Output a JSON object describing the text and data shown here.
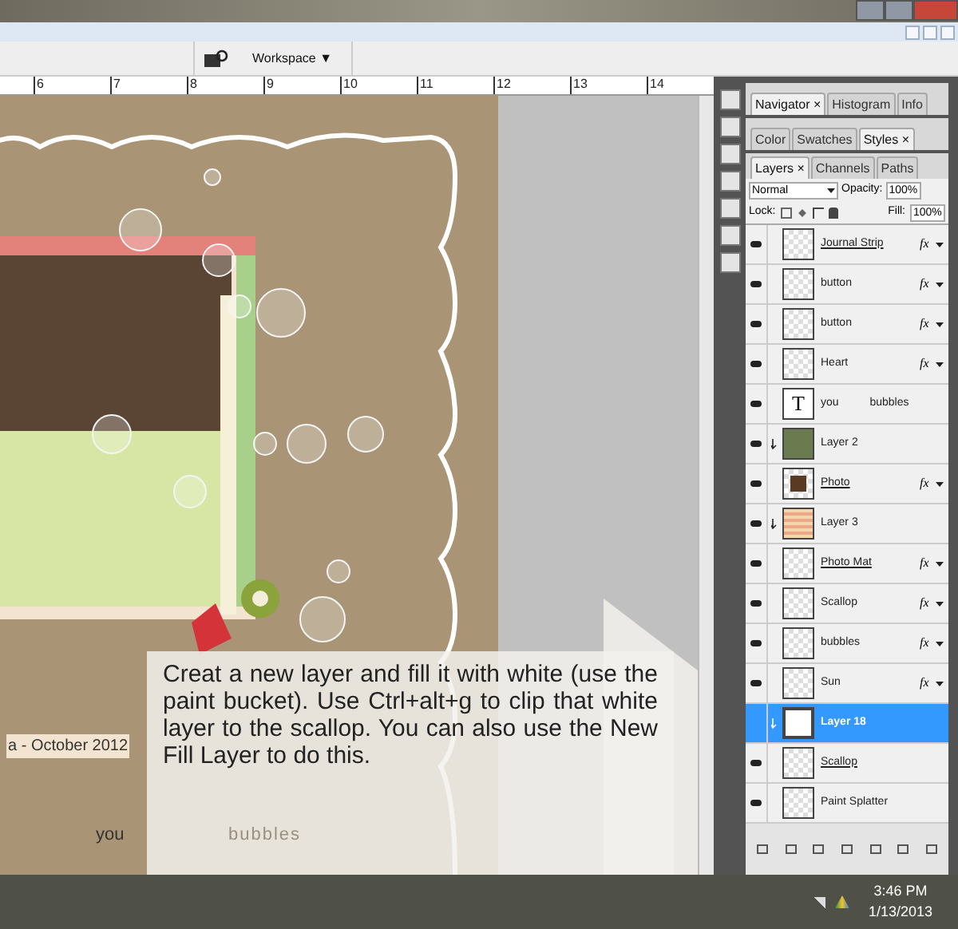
{
  "app_bar": {
    "workspace": "Workspace ▼"
  },
  "ruler": {
    "marks": [
      "6",
      "7",
      "8",
      "9",
      "10",
      "11",
      "12",
      "13",
      "14"
    ]
  },
  "canvas_texts": [
    {
      "text": "a - October 2012",
      "kind": "date"
    },
    {
      "text": "you",
      "kind": "word"
    },
    {
      "text": "bubbles",
      "kind": "word"
    }
  ],
  "callout": {
    "text": "Creat a new layer and fill it with white (use the paint bucket). Use Ctrl+alt+g to clip that white layer to the scallop. You can also use the New Fill Layer to do this."
  },
  "panel_groups": [
    {
      "tabs": [
        {
          "label": "Navigator",
          "selected": true,
          "close": "×"
        },
        {
          "label": "Histogram",
          "selected": false
        },
        {
          "label": "Info",
          "selected": false
        }
      ]
    },
    {
      "tabs": [
        {
          "label": "Color",
          "selected": false
        },
        {
          "label": "Swatches",
          "selected": false
        },
        {
          "label": "Styles",
          "selected": true,
          "close": "×"
        }
      ]
    }
  ],
  "layers_panel": {
    "tabs": [
      {
        "label": "Layers",
        "selected": true,
        "close": "×"
      },
      {
        "label": "Channels",
        "selected": false
      },
      {
        "label": "Paths",
        "selected": false
      }
    ],
    "blend_mode": "Normal",
    "opacity_label": "Opacity:",
    "opacity": "100%",
    "lock_label": "Lock:",
    "fill_label": "Fill:",
    "fill": "100%",
    "layers": [
      {
        "name": "Journal Strip",
        "kind": "empty",
        "visible": true,
        "effects": "fx",
        "clipped": false,
        "underlined": true,
        "selected": false
      },
      {
        "name": "button",
        "kind": "empty",
        "visible": true,
        "effects": "fx",
        "clipped": false,
        "underlined": false,
        "selected": false
      },
      {
        "name": "button",
        "kind": "empty",
        "visible": true,
        "effects": "fx",
        "clipped": false,
        "underlined": false,
        "selected": false
      },
      {
        "name": "Heart",
        "kind": "empty",
        "visible": true,
        "effects": "fx",
        "clipped": false,
        "underlined": false,
        "selected": false
      },
      {
        "name": "you          bubbles",
        "kind": "text",
        "thumb_label": "T",
        "visible": true,
        "clipped": false,
        "underlined": false,
        "selected": false
      },
      {
        "name": "Layer 2",
        "kind": "photo",
        "visible": true,
        "clipped": true,
        "underlined": false,
        "selected": false
      },
      {
        "name": "Photo",
        "kind": "brown",
        "visible": true,
        "effects": "fx",
        "clipped": false,
        "underlined": true,
        "selected": false
      },
      {
        "name": "Layer 3",
        "kind": "pattern",
        "visible": true,
        "clipped": true,
        "underlined": false,
        "selected": false
      },
      {
        "name": "Photo Mat",
        "kind": "empty",
        "visible": true,
        "effects": "fx",
        "clipped": false,
        "underlined": true,
        "selected": false
      },
      {
        "name": "Scallop",
        "kind": "empty",
        "visible": true,
        "effects": "fx",
        "clipped": false,
        "underlined": false,
        "selected": false
      },
      {
        "name": "bubbles",
        "kind": "empty",
        "visible": true,
        "effects": "fx",
        "clipped": false,
        "underlined": false,
        "selected": false
      },
      {
        "name": "Sun",
        "kind": "empty",
        "visible": true,
        "effects": "fx",
        "clipped": false,
        "underlined": false,
        "selected": false
      },
      {
        "name": "Layer 18",
        "kind": "white",
        "visible": false,
        "clipped": true,
        "underlined": false,
        "selected": true
      },
      {
        "name": "Scallop",
        "kind": "empty",
        "visible": true,
        "clipped": false,
        "underlined": true,
        "selected": false
      },
      {
        "name": "Paint Splatter",
        "kind": "empty",
        "visible": true,
        "clipped": false,
        "underlined": false,
        "selected": false
      }
    ]
  },
  "taskbar": {
    "time": "3:46 PM",
    "date": "1/13/2013"
  }
}
